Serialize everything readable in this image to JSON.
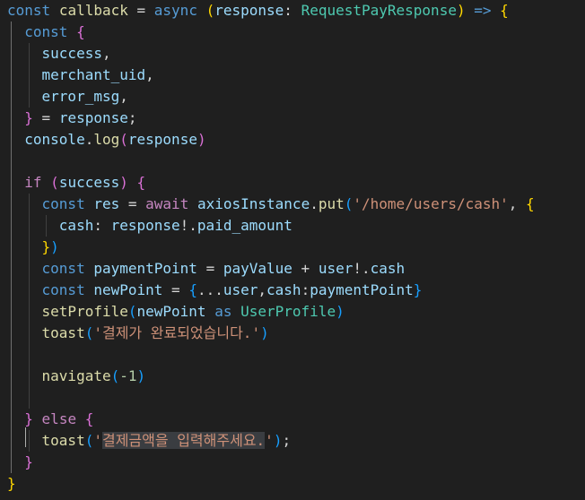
{
  "editor": {
    "theme_background": "#1f1f1f",
    "lines": [
      [
        [
          "kw",
          "const"
        ],
        [
          "pun",
          " "
        ],
        [
          "fn",
          "callback"
        ],
        [
          "pun",
          " = "
        ],
        [
          "kw",
          "async"
        ],
        [
          "pun",
          " "
        ],
        [
          "b1",
          "("
        ],
        [
          "var",
          "response"
        ],
        [
          "pun",
          ": "
        ],
        [
          "typ",
          "RequestPayResponse"
        ],
        [
          "b1",
          ")"
        ],
        [
          "pun",
          " "
        ],
        [
          "kw",
          "=>"
        ],
        [
          "pun",
          " "
        ],
        [
          "b1",
          "{"
        ]
      ],
      [
        [
          "pun",
          "  "
        ],
        [
          "kw",
          "const"
        ],
        [
          "pun",
          " "
        ],
        [
          "b2",
          "{"
        ]
      ],
      [
        [
          "pun",
          "    "
        ],
        [
          "var",
          "success"
        ],
        [
          "pun",
          ","
        ]
      ],
      [
        [
          "pun",
          "    "
        ],
        [
          "var",
          "merchant_uid"
        ],
        [
          "pun",
          ","
        ]
      ],
      [
        [
          "pun",
          "    "
        ],
        [
          "var",
          "error_msg"
        ],
        [
          "pun",
          ","
        ]
      ],
      [
        [
          "pun",
          "  "
        ],
        [
          "b2",
          "}"
        ],
        [
          "pun",
          " = "
        ],
        [
          "var",
          "response"
        ],
        [
          "pun",
          ";"
        ]
      ],
      [
        [
          "pun",
          "  "
        ],
        [
          "var",
          "console"
        ],
        [
          "pun",
          "."
        ],
        [
          "fn",
          "log"
        ],
        [
          "b2",
          "("
        ],
        [
          "var",
          "response"
        ],
        [
          "b2",
          ")"
        ]
      ],
      [],
      [
        [
          "pun",
          "  "
        ],
        [
          "ctl",
          "if"
        ],
        [
          "pun",
          " "
        ],
        [
          "b2",
          "("
        ],
        [
          "var",
          "success"
        ],
        [
          "b2",
          ")"
        ],
        [
          "pun",
          " "
        ],
        [
          "b2",
          "{"
        ]
      ],
      [
        [
          "pun",
          "    "
        ],
        [
          "kw",
          "const"
        ],
        [
          "pun",
          " "
        ],
        [
          "var",
          "res"
        ],
        [
          "pun",
          " = "
        ],
        [
          "ctl",
          "await"
        ],
        [
          "pun",
          " "
        ],
        [
          "var",
          "axiosInstance"
        ],
        [
          "pun",
          "."
        ],
        [
          "fn",
          "put"
        ],
        [
          "b3",
          "("
        ],
        [
          "str",
          "'/home/users/cash'"
        ],
        [
          "pun",
          ", "
        ],
        [
          "b1",
          "{"
        ]
      ],
      [
        [
          "pun",
          "      "
        ],
        [
          "var",
          "cash"
        ],
        [
          "pun",
          ": "
        ],
        [
          "var",
          "response"
        ],
        [
          "pun",
          "!."
        ],
        [
          "var",
          "paid_amount"
        ]
      ],
      [
        [
          "pun",
          "    "
        ],
        [
          "b1",
          "}"
        ],
        [
          "b3",
          ")"
        ]
      ],
      [
        [
          "pun",
          "    "
        ],
        [
          "kw",
          "const"
        ],
        [
          "pun",
          " "
        ],
        [
          "var",
          "paymentPoint"
        ],
        [
          "pun",
          " = "
        ],
        [
          "var",
          "payValue"
        ],
        [
          "pun",
          " + "
        ],
        [
          "var",
          "user"
        ],
        [
          "pun",
          "!."
        ],
        [
          "var",
          "cash"
        ]
      ],
      [
        [
          "pun",
          "    "
        ],
        [
          "kw",
          "const"
        ],
        [
          "pun",
          " "
        ],
        [
          "var",
          "newPoint"
        ],
        [
          "pun",
          " = "
        ],
        [
          "b3",
          "{"
        ],
        [
          "pun",
          "..."
        ],
        [
          "var",
          "user"
        ],
        [
          "pun",
          ","
        ],
        [
          "var",
          "cash"
        ],
        [
          "pun",
          ":"
        ],
        [
          "var",
          "paymentPoint"
        ],
        [
          "b3",
          "}"
        ]
      ],
      [
        [
          "pun",
          "    "
        ],
        [
          "fn",
          "setProfile"
        ],
        [
          "b3",
          "("
        ],
        [
          "var",
          "newPoint"
        ],
        [
          "pun",
          " "
        ],
        [
          "kw",
          "as"
        ],
        [
          "pun",
          " "
        ],
        [
          "typ",
          "UserProfile"
        ],
        [
          "b3",
          ")"
        ]
      ],
      [
        [
          "pun",
          "    "
        ],
        [
          "fn",
          "toast"
        ],
        [
          "b3",
          "("
        ],
        [
          "str",
          "'결제가 완료되었습니다.'"
        ],
        [
          "b3",
          ")"
        ]
      ],
      [],
      [
        [
          "pun",
          "    "
        ],
        [
          "fn",
          "navigate"
        ],
        [
          "b3",
          "("
        ],
        [
          "num",
          "-1"
        ],
        [
          "b3",
          ")"
        ]
      ],
      [],
      [
        [
          "pun",
          "  "
        ],
        [
          "b2",
          "}"
        ],
        [
          "pun",
          " "
        ],
        [
          "ctl",
          "else"
        ],
        [
          "pun",
          " "
        ],
        [
          "b2",
          "{"
        ]
      ],
      [
        [
          "pun",
          "    "
        ],
        [
          "fn",
          "toast"
        ],
        [
          "b3",
          "("
        ],
        [
          "str",
          "'"
        ],
        [
          "str sel",
          "결제금액을 입력해주세요."
        ],
        [
          "str",
          "'"
        ],
        [
          "b3",
          ")"
        ],
        [
          "pun",
          ";"
        ]
      ],
      [
        [
          "pun",
          "  "
        ],
        [
          "b2",
          "}"
        ]
      ],
      [
        [
          "b1",
          "}"
        ]
      ]
    ]
  }
}
